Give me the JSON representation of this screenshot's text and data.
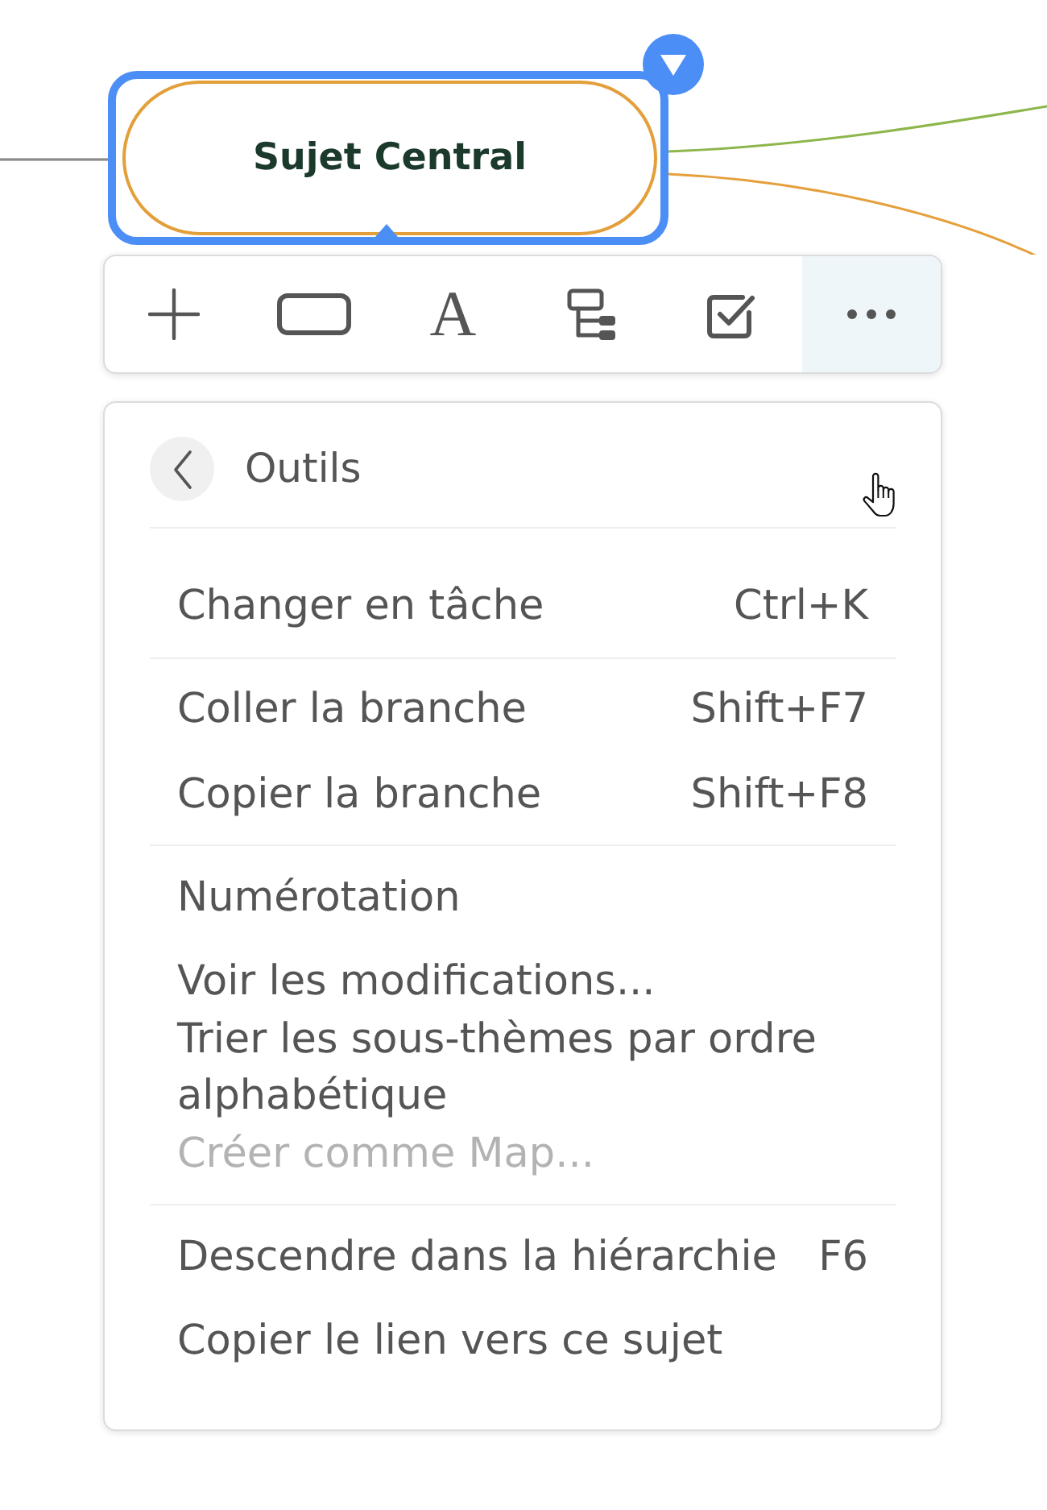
{
  "canvas": {
    "branches": [
      {
        "color": "#8a8a8a"
      },
      {
        "color": "#8db64c"
      },
      {
        "color": "#e5a03c"
      }
    ],
    "central_topic": {
      "label": "Sujet Central",
      "selected": true
    }
  },
  "toolbar": {
    "buttons": [
      {
        "kind": "add",
        "selected": false
      },
      {
        "kind": "shape",
        "selected": false
      },
      {
        "kind": "text",
        "glyph": "A",
        "selected": false
      },
      {
        "kind": "structure",
        "selected": false
      },
      {
        "kind": "task",
        "selected": false
      },
      {
        "kind": "more",
        "selected": true
      }
    ]
  },
  "menu": {
    "title": "Outils",
    "sections": [
      {
        "items": [
          {
            "label": "Changer en tâche",
            "shortcut": "Ctrl+K",
            "disabled": false
          }
        ]
      },
      {
        "items": [
          {
            "label": "Coller la branche",
            "shortcut": "Shift+F7",
            "disabled": false
          },
          {
            "label": "Copier la branche",
            "shortcut": "Shift+F8",
            "disabled": false
          }
        ]
      },
      {
        "items": [
          {
            "label": "Numérotation",
            "disabled": false
          },
          {
            "label": "Voir les modifications...",
            "disabled": false
          },
          {
            "label": "Trier les sous-thèmes par ordre alphabétique",
            "disabled": false
          },
          {
            "label": "Créer comme Map...",
            "disabled": true
          }
        ]
      },
      {
        "items": [
          {
            "label": "Descendre dans la hiérarchie",
            "shortcut": "F6",
            "disabled": false
          },
          {
            "label": "Copier le lien vers ce sujet",
            "disabled": false
          }
        ]
      }
    ]
  }
}
